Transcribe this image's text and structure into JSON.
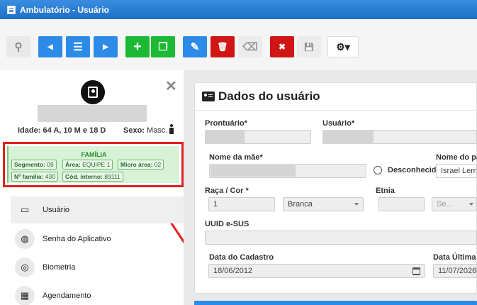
{
  "window": {
    "title": "Ambulatório - Usuário"
  },
  "toolbar": {
    "buttons": [
      {
        "name": "search-button",
        "icon": "search-icon",
        "glyph": "⚲"
      },
      {
        "name": "previous-button",
        "icon": "arrow-left-circle-icon",
        "glyph": "◀"
      },
      {
        "name": "list-button",
        "icon": "list-icon",
        "glyph": "☰"
      },
      {
        "name": "next-button",
        "icon": "arrow-right-circle-icon",
        "glyph": "▶"
      },
      {
        "name": "add-button",
        "icon": "plus-icon",
        "glyph": "+"
      },
      {
        "name": "copy-button",
        "icon": "copy-icon",
        "glyph": "❐"
      },
      {
        "name": "edit-button",
        "icon": "edit-icon",
        "glyph": "✎"
      },
      {
        "name": "delete-button",
        "icon": "trash-icon",
        "glyph": "🗑"
      },
      {
        "name": "clear-button",
        "icon": "eraser-icon",
        "glyph": "⌫"
      },
      {
        "name": "cancel-button",
        "icon": "close-circle-icon",
        "glyph": "✖"
      },
      {
        "name": "save-button",
        "icon": "save-icon",
        "glyph": "💾"
      },
      {
        "name": "settings-button",
        "icon": "gear-dropdown-icon",
        "glyph": "⚙▾"
      }
    ]
  },
  "patient": {
    "age": "Idade: 64 A, 10 M e 18 D",
    "sex_label": "Sexo:",
    "sex_value": "Masc."
  },
  "familia": {
    "title": "FAMÍLIA",
    "segment_label": "Segmento:",
    "segment_value": "09",
    "area_label": "Área:",
    "area_value": "EQUIPE 1",
    "micro_label": "Micro área:",
    "micro_value": "02",
    "family_no_label": "Nº família:",
    "family_no_value": "430",
    "internal_code_label": "Cód. interno:",
    "internal_code_value": "89111"
  },
  "menu": [
    {
      "label": "Usuário",
      "icon": "id-card-icon",
      "glyph": "▭"
    },
    {
      "label": "Senha do Aplicativo",
      "icon": "globe-icon",
      "glyph": "◍"
    },
    {
      "label": "Biometria",
      "icon": "fingerprint-icon",
      "glyph": "◎"
    },
    {
      "label": "Agendamento",
      "icon": "calendar-icon",
      "glyph": "▦"
    }
  ],
  "form": {
    "title": "Dados do usuário",
    "prontuario_label": "Prontuário*",
    "usuario_label": "Usuário*",
    "mae_label": "Nome da mãe*",
    "desconhecido_label": "Desconhecid",
    "pai_label": "Nome do pa",
    "pai_value": "Israel Lem",
    "raca_label": "Raça / Cor *",
    "raca_code": "1",
    "raca_value": "Branca",
    "etnia_label": "Etnia",
    "etnia_placeholder": "Se...",
    "uuid_label": "UUID e-SUS",
    "cadastro_label": "Data do Cadastro",
    "cadastro_value": "18/06/2012",
    "ultima_label": "Data Última",
    "ultima_value": "11/07/2026"
  }
}
